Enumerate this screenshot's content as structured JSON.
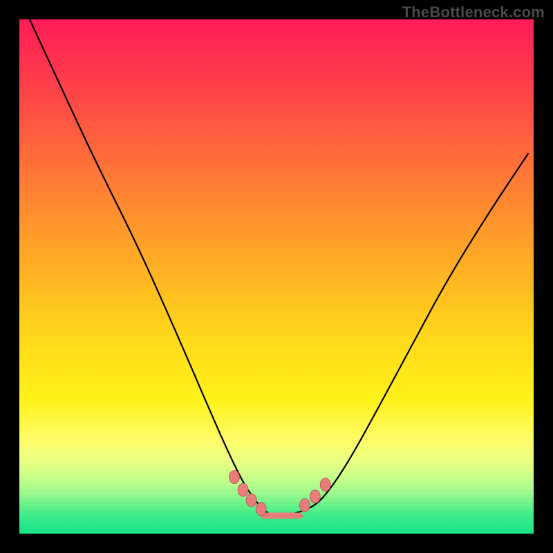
{
  "watermark": "TheBottleneck.com",
  "colors": {
    "gradient_top": "#ff1c58",
    "gradient_bottom": "#18e486",
    "curve": "#000000",
    "marker_fill": "#e87a78",
    "marker_stroke": "#b04e4e",
    "frame": "#000000"
  },
  "chart_data": {
    "type": "line",
    "title": "",
    "xlabel": "",
    "ylabel": "",
    "xlim": [
      0,
      1
    ],
    "ylim": [
      0,
      1
    ],
    "note": "Axes are unlabeled in the source image; all coordinates are normalized (0–1) estimates read from the pixels.",
    "series": [
      {
        "name": "v-curve",
        "x": [
          0.02,
          0.08,
          0.15,
          0.23,
          0.31,
          0.37,
          0.41,
          0.44,
          0.47,
          0.49,
          0.52,
          0.57,
          0.6,
          0.64,
          0.69,
          0.76,
          0.83,
          0.91,
          0.99
        ],
        "y": [
          1.0,
          0.87,
          0.72,
          0.56,
          0.38,
          0.24,
          0.15,
          0.09,
          0.05,
          0.035,
          0.035,
          0.05,
          0.08,
          0.14,
          0.23,
          0.36,
          0.49,
          0.62,
          0.74
        ]
      }
    ],
    "markers": {
      "name": "highlight-points",
      "x": [
        0.418,
        0.435,
        0.451,
        0.47,
        0.555,
        0.575,
        0.595
      ],
      "y": [
        0.11,
        0.085,
        0.065,
        0.048,
        0.055,
        0.072,
        0.095
      ]
    },
    "flat_segment": {
      "x": [
        0.475,
        0.545
      ],
      "y": 0.035
    }
  }
}
